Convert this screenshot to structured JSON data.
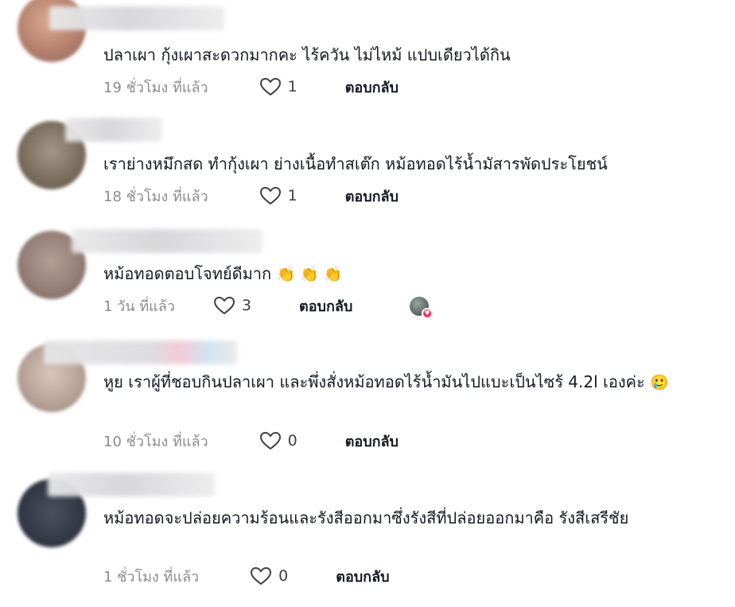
{
  "comments": [
    {
      "text": "ปลาเผา กุ้งเผาสะดวกมากคะ ไร้ควัน ไม่ไหม้ แปบเดียวได้กิน",
      "time": "19 ชั่วโมง ที่แล้ว",
      "likes": "1",
      "reply_label": "ตอบกลับ",
      "emoji": ""
    },
    {
      "text": "เราย่างหมึกสด ทำกุ้งเผา ย่างเนื้อทำสเต๊ก หม้อทอดไร้น้ำมัสารพัดประโยชน์",
      "time": "18 ชั่วโมง ที่แล้ว",
      "likes": "1",
      "reply_label": "ตอบกลับ",
      "emoji": ""
    },
    {
      "text": "หม้อทอดตอบโจทย์ดีมาก",
      "time": "1 วัน ที่แล้ว",
      "likes": "3",
      "reply_label": "ตอบกลับ",
      "emoji": "👏 👏 👏",
      "creator_liked": true
    },
    {
      "text": "หูย เราผู้ที่ชอบกินปลาเผา และพึ่งสั่งหม้อทอดไร้น้ำมันไปแบะเป็นไซร้ 4.2l เองค่ะ",
      "time": "10 ชั่วโมง ที่แล้ว",
      "likes": "0",
      "reply_label": "ตอบกลับ",
      "emoji": "🥲"
    },
    {
      "text": "หม้อทอดจะปล่อยความร้อนและรังสีออกมาซึ่งรังสีที่ปล่อยออกมาคือ รังสีเสรีชัย",
      "time": "1 ชั่วโมง ที่แล้ว",
      "likes": "0",
      "reply_label": "ตอบกลับ",
      "emoji": ""
    }
  ],
  "colors": {
    "text": "#161823",
    "meta": "#8a8b91",
    "heart_outline": "#3f4048",
    "badge": "#fe2c55"
  },
  "icons": {
    "like": "heart-outline-icon",
    "creator_badge": "heart-badge-icon"
  }
}
